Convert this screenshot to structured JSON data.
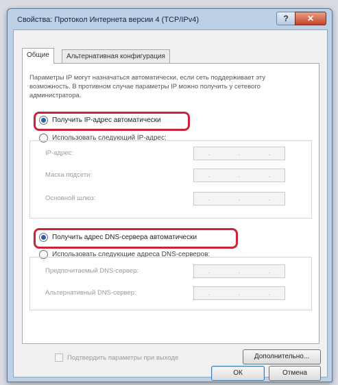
{
  "window": {
    "title": "Свойства: Протокол Интернета версии 4 (TCP/IPv4)",
    "help_label": "?",
    "close_label": "✕"
  },
  "tabs": [
    {
      "label": "Общие",
      "active": true
    },
    {
      "label": "Альтернативная конфигурация",
      "active": false
    }
  ],
  "description": "Параметры IP могут назначаться автоматически, если сеть поддерживает эту возможность. В противном случае параметры IP можно получить у сетевого администратора.",
  "ip": {
    "auto_label": "Получить IP-адрес автоматически",
    "auto_selected": true,
    "manual_label": "Использовать следующий IP-адрес:",
    "manual_selected": false,
    "fields": [
      {
        "label": "IP-адрес:"
      },
      {
        "label": "Маска подсети:"
      },
      {
        "label": "Основной шлюз:"
      }
    ]
  },
  "dns": {
    "auto_label": "Получить адрес DNS-сервера автоматически",
    "auto_selected": true,
    "manual_label": "Использовать следующие адреса DNS-серверов:",
    "manual_selected": false,
    "fields": [
      {
        "label": "Предпочитаемый DNS-сервер:"
      },
      {
        "label": "Альтернативный DNS-сервер:"
      }
    ]
  },
  "validate_label": "Подтвердить параметры при выходе",
  "buttons": {
    "advanced": "Дополнительно...",
    "ok": "ОК",
    "cancel": "Отмена"
  },
  "ip_separator": ".",
  "colors": {
    "highlight": "#d0213c",
    "accent": "#2c5fb0"
  }
}
